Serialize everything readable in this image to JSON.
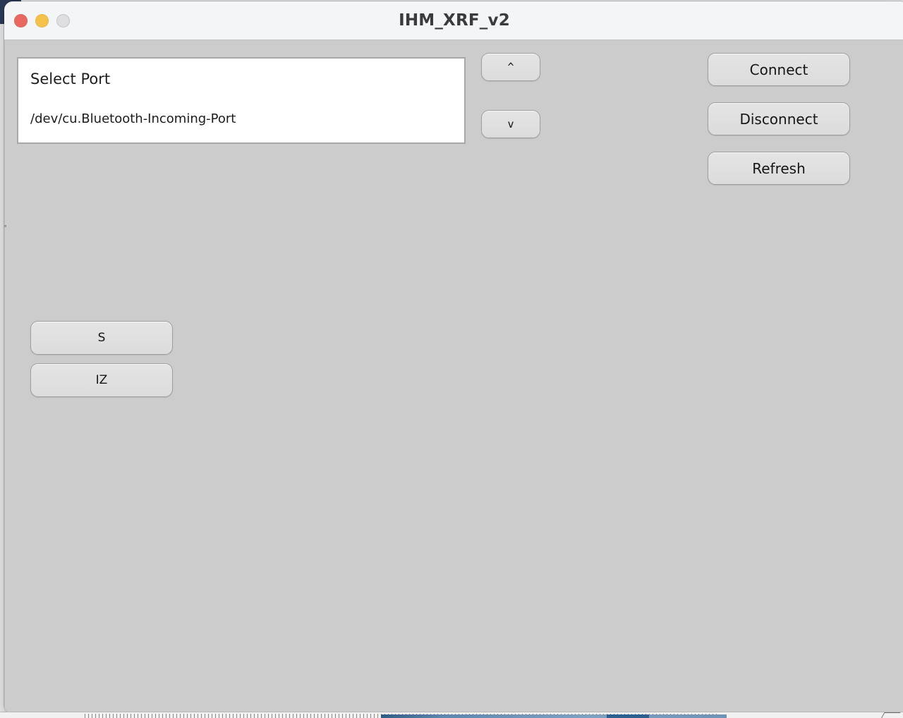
{
  "window": {
    "title": "IHM_XRF_v2",
    "traffic_lights": [
      {
        "name": "close",
        "color": "#e8685f"
      },
      {
        "name": "minimize",
        "color": "#f4c14a"
      },
      {
        "name": "zoom",
        "color": "#dedee0"
      }
    ],
    "titlebar_bg": "#f4f5f6",
    "content_bg": "#cccccc"
  },
  "port_list": {
    "header": "Select Port",
    "options": [
      "/dev/cu.Bluetooth-Incoming-Port"
    ],
    "selected": ""
  },
  "spinner": {
    "up_label": "^",
    "down_label": "v"
  },
  "connection_buttons": [
    {
      "label": "Connect"
    },
    {
      "label": "Disconnect"
    },
    {
      "label": "Refresh"
    }
  ],
  "command_buttons": [
    {
      "label": "S"
    },
    {
      "label": "IZ"
    }
  ]
}
